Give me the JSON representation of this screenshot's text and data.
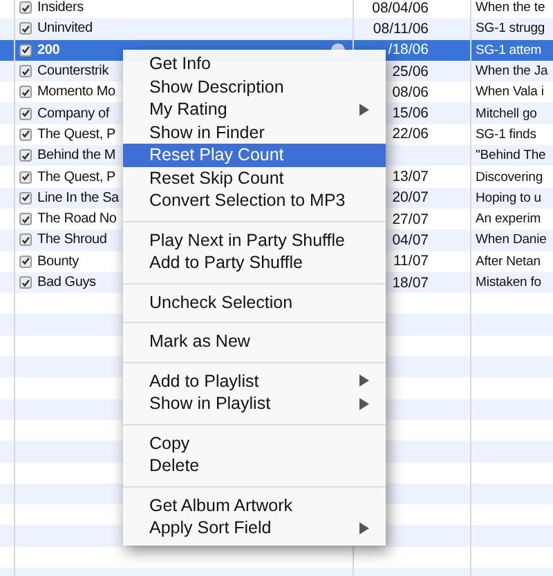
{
  "tracks": [
    {
      "name": "Insiders",
      "checked": true,
      "selected": false,
      "date": "08/04/06",
      "description": "When the te"
    },
    {
      "name": "Uninvited",
      "checked": true,
      "selected": false,
      "date": "08/11/06",
      "description": "SG-1 strugg"
    },
    {
      "name": "200",
      "checked": true,
      "selected": true,
      "date": "/18/06",
      "description": "SG-1 attem"
    },
    {
      "name": "Counterstrik",
      "checked": true,
      "selected": false,
      "date": "25/06",
      "description": "When the Ja"
    },
    {
      "name": "Momento Mo",
      "checked": true,
      "selected": false,
      "date": "08/06",
      "description": "When Vala i"
    },
    {
      "name": "Company of",
      "checked": true,
      "selected": false,
      "date": "15/06",
      "description": "Mitchell go"
    },
    {
      "name": "The Quest, P",
      "checked": true,
      "selected": false,
      "date": "22/06",
      "description": "SG-1 finds"
    },
    {
      "name": "Behind the M",
      "checked": true,
      "selected": false,
      "description": "\"Behind The"
    },
    {
      "name": "The Quest, P",
      "checked": true,
      "selected": false,
      "date": "13/07",
      "description": "Discovering"
    },
    {
      "name": "Line In the Sa",
      "checked": true,
      "selected": false,
      "date": "20/07",
      "description": "Hoping to u"
    },
    {
      "name": "The Road No",
      "checked": true,
      "selected": false,
      "date": "27/07",
      "description": "An experim"
    },
    {
      "name": "The Shroud",
      "checked": true,
      "selected": false,
      "date": "04/07",
      "description": "When Danie"
    },
    {
      "name": "Bounty",
      "checked": true,
      "selected": false,
      "date": "11/07",
      "description": "After Netan"
    },
    {
      "name": "Bad Guys",
      "checked": true,
      "selected": false,
      "date": "18/07",
      "description": "Mistaken fo"
    }
  ],
  "context_menu": {
    "sections": [
      [
        {
          "label": "Get Info",
          "submenu": false,
          "selected": false
        },
        {
          "label": "Show Description",
          "submenu": false,
          "selected": false
        },
        {
          "label": "My Rating",
          "submenu": true,
          "selected": false
        },
        {
          "label": "Show in Finder",
          "submenu": false,
          "selected": false
        },
        {
          "label": "Reset Play Count",
          "submenu": false,
          "selected": true
        },
        {
          "label": "Reset Skip Count",
          "submenu": false,
          "selected": false
        },
        {
          "label": "Convert Selection to MP3",
          "submenu": false,
          "selected": false
        }
      ],
      [
        {
          "label": "Play Next in Party Shuffle",
          "submenu": false,
          "selected": false
        },
        {
          "label": "Add to Party Shuffle",
          "submenu": false,
          "selected": false
        }
      ],
      [
        {
          "label": "Uncheck Selection",
          "submenu": false,
          "selected": false
        }
      ],
      [
        {
          "label": "Mark as New",
          "submenu": false,
          "selected": false
        }
      ],
      [
        {
          "label": "Add to Playlist",
          "submenu": true,
          "selected": false
        },
        {
          "label": "Show in Playlist",
          "submenu": true,
          "selected": false
        }
      ],
      [
        {
          "label": "Copy",
          "submenu": false,
          "selected": false
        },
        {
          "label": "Delete",
          "submenu": false,
          "selected": false
        }
      ],
      [
        {
          "label": "Get Album Artwork",
          "submenu": false,
          "selected": false
        },
        {
          "label": "Apply Sort Field",
          "submenu": true,
          "selected": false
        }
      ]
    ]
  }
}
